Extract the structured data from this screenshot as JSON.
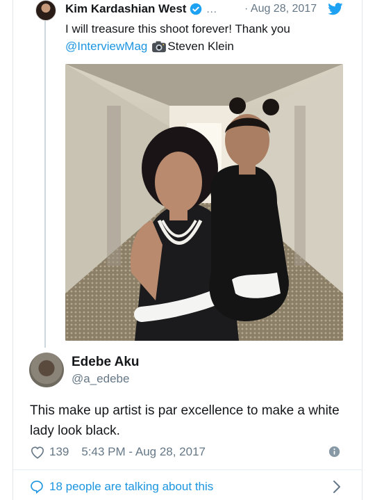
{
  "quoted_tweet": {
    "author_name": "Kim Kardashian West",
    "more": "...",
    "date": "· Aug 28, 2017",
    "text": "I will treasure this shoot forever! Thank you",
    "mention": "@InterviewMag",
    "credit": "Steven Klein",
    "icons": {
      "verified": "verified-badge-icon",
      "brand": "twitter-bird-icon",
      "camera": "camera-emoji-icon"
    }
  },
  "reply_tweet": {
    "author_name": "Edebe Aku",
    "handle": "@a_edebe",
    "text": "This make up artist is par excellence to make a white lady look black.",
    "like_count": "139",
    "timestamp": "5:43 PM - Aug 28, 2017",
    "talking": "18 people are talking about this"
  },
  "colors": {
    "accent": "#1b95e0",
    "muted": "#657786",
    "text": "#14171a"
  }
}
